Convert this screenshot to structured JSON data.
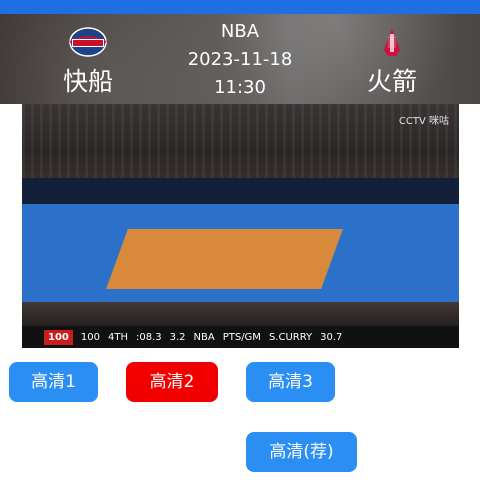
{
  "header": {
    "league": "NBA",
    "date": "2023-11-18",
    "time": "11:30",
    "home_team": "快船",
    "away_team": "火箭"
  },
  "video": {
    "watermark": "CCTV 咪咕",
    "scorebar": {
      "away_score": "100",
      "home_score": "100",
      "quarter": "4TH",
      "clock": ":08.3",
      "shot_clock": "3.2",
      "league": "NBA",
      "stat_label": "PTS/GM",
      "player": "S.CURRY",
      "player_stat": "30.7"
    }
  },
  "buttons": {
    "hd1": "高清1",
    "hd2": "高清2",
    "hd3": "高清3",
    "hd_rec": "高清(荐)"
  },
  "colors": {
    "accent": "#2a8ef2",
    "active": "#f20000",
    "topbar": "#1f6fe0"
  }
}
